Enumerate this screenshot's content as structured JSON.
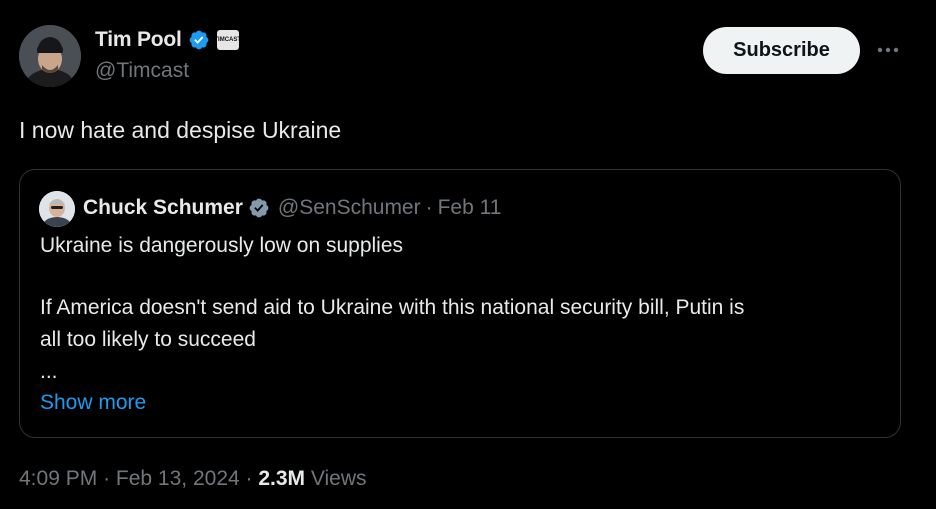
{
  "tweet": {
    "author": {
      "name": "Tim Pool",
      "handle": "@Timcast",
      "affiliate_badge_text": "TIMCAST"
    },
    "subscribe_label": "Subscribe",
    "more_label": "···",
    "text": "I now hate and despise Ukraine",
    "quote": {
      "author_name": "Chuck Schumer",
      "author_handle": "@SenSchumer",
      "separator": "·",
      "date": "Feb 11",
      "line1": "Ukraine is dangerously low on supplies",
      "line2": "If America doesn't send aid to Ukraine with this national security bill, Putin is",
      "line3": "all too likely to succeed",
      "ellipsis": "...",
      "show_more": "Show more"
    },
    "meta": {
      "time": "4:09 PM",
      "sep1": "·",
      "date": "Feb 13, 2024",
      "sep2": "·",
      "views_count": "2.3M",
      "views_label": "Views"
    }
  },
  "icons": {
    "verified": "verified-badge-icon",
    "more": "more-dots-icon"
  },
  "colors": {
    "background": "#000000",
    "primary_text": "#e7e9ea",
    "secondary_text": "#71767b",
    "link": "#1d9bf0",
    "verified_blue": "#1d9bf0",
    "verified_gray": "#829aab",
    "border": "#2f3336",
    "button_bg": "#eff3f4"
  }
}
